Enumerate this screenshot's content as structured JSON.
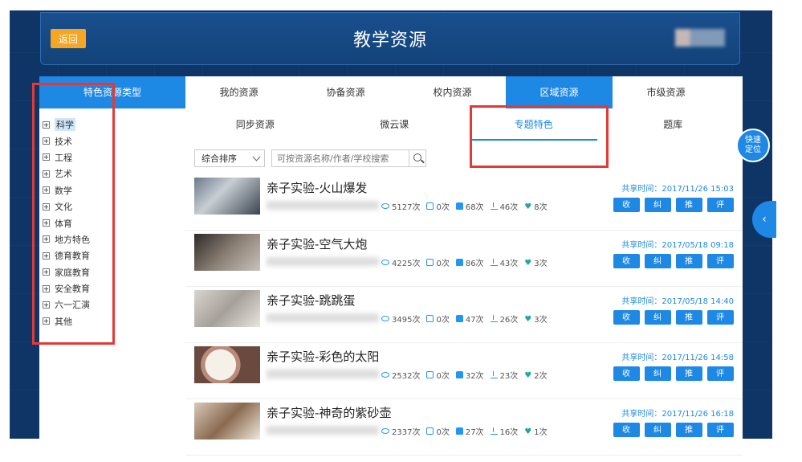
{
  "header": {
    "title": "教学资源",
    "back_label": "返回"
  },
  "tabs": [
    {
      "label": "特色资源类型",
      "active": true,
      "w": 182
    },
    {
      "label": "我的资源",
      "active": false,
      "w": 133
    },
    {
      "label": "协备资源",
      "active": false,
      "w": 133
    },
    {
      "label": "校内资源",
      "active": false,
      "w": 133
    },
    {
      "label": "区域资源",
      "active": true,
      "w": 133
    },
    {
      "label": "市级资源",
      "active": false,
      "w": 133
    }
  ],
  "subtabs": [
    "同步资源",
    "微云课",
    "专题特色",
    "题库"
  ],
  "categories": [
    "科学",
    "技术",
    "工程",
    "艺术",
    "数学",
    "文化",
    "体育",
    "地方特色",
    "德育教育",
    "家庭教育",
    "安全教育",
    "六一汇演",
    "其他"
  ],
  "toolbar": {
    "sort_label": "综合排序",
    "search_placeholder": "可按资源名称/作者/学校搜索"
  },
  "list": [
    {
      "title": "亲子实验-火山爆发",
      "views": "5127次",
      "check": "0次",
      "likes": "68次",
      "downloads": "46次",
      "favs": "8次",
      "time": "共享时间：2017/11/26 15:03"
    },
    {
      "title": "亲子实验-空气大炮",
      "views": "4225次",
      "check": "0次",
      "likes": "86次",
      "downloads": "43次",
      "favs": "3次",
      "time": "共享时间：2017/05/18 09:18"
    },
    {
      "title": "亲子实验-跳跳蛋",
      "views": "3495次",
      "check": "0次",
      "likes": "47次",
      "downloads": "26次",
      "favs": "3次",
      "time": "共享时间：2017/05/18 14:40"
    },
    {
      "title": "亲子实验-彩色的太阳",
      "views": "2532次",
      "check": "0次",
      "likes": "32次",
      "downloads": "23次",
      "favs": "2次",
      "time": "共享时间：2017/11/26 14:58"
    },
    {
      "title": "亲子实验-神奇的紫砂壶",
      "views": "2337次",
      "check": "0次",
      "likes": "27次",
      "downloads": "16次",
      "favs": "1次",
      "time": "共享时间：2017/11/26 16:18"
    }
  ],
  "actions": [
    "收藏",
    "纠错",
    "推荐",
    "评论"
  ],
  "quick_locate": "快速\n定位",
  "side_arrow": "‹",
  "colors": {
    "accent": "#1e88e5",
    "back_button": "#f5a623",
    "highlight": "#e53935",
    "header_bg": "#124379"
  }
}
